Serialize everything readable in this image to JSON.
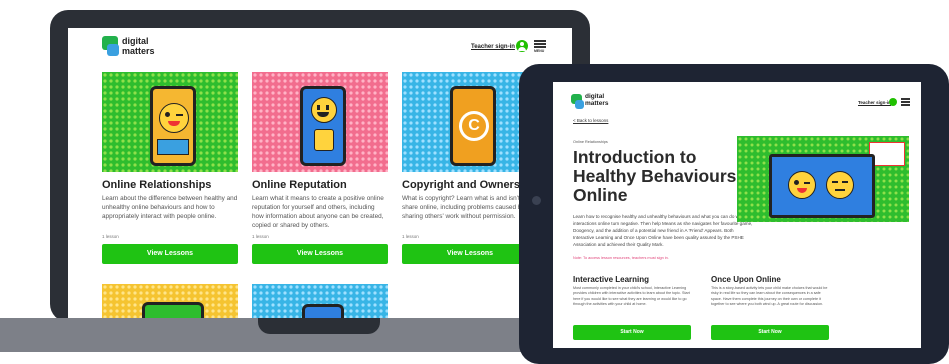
{
  "laptop": {
    "brand_line1": "digital",
    "brand_line2": "matters",
    "teacher_signin": "Teacher sign-in",
    "menu_label": "MENU",
    "cards": [
      {
        "title": "Online Relationships",
        "desc": "Learn about the difference between healthy and unhealthy online behaviours and how to appropriately interact with people online.",
        "lessons": "1 lesson",
        "button": "View Lessons",
        "bg": "#2ebd2e"
      },
      {
        "title": "Online Reputation",
        "desc": "Learn what it means to create a positive online reputation for yourself and others, including how information about anyone can be created, copied or shared by others.",
        "lessons": "1 lesson",
        "button": "View Lessons",
        "bg": "#f26d8e"
      },
      {
        "title": "Copyright and Ownership",
        "desc": "What is copyright? Learn what is and isn't ok to share online, including problems caused by sharing others' work without permission.",
        "lessons": "1 lesson",
        "button": "View Lessons",
        "bg": "#38b5e6"
      }
    ]
  },
  "tablet": {
    "brand_line1": "digital",
    "brand_line2": "matters",
    "teacher_signin": "Teacher sign-in",
    "back_link": "< Back to lessons",
    "category": "Online Relationships",
    "title": "Introduction to Healthy Behaviours Online",
    "intro": "Learn how to recognise healthy and unhealthy behaviours and what you can do when interactions online turn negative. Then help Means as she navigates her favourite game, Doogency, and the addition of a potential new friend in A 'Friend' Appears. Both Interactive Learning and Once Upon Online have been quality assured by the PSHE Association and achieved their Quality Mark.",
    "note": "Note: To access lesson resources, teachers must sign in.",
    "sections": [
      {
        "title": "Interactive Learning",
        "desc": "Most commonly completed in your child's school, Interactive Learning provides children with interactive activities to learn about the topic. Start here if you would like to see what they are learning or would like to go through the activities with your child at home.",
        "button": "Start Now"
      },
      {
        "title": "Once Upon Online",
        "desc": "This is a story-based activity lets your child make choices that would be risky in real life so they can learn about the consequences in a safe space. Have them complete this journey on their own or complete it together to see where you both wind up. A great route for discussion.",
        "button": "Start Now"
      }
    ]
  },
  "colors": {
    "accent_green": "#1fc313",
    "dark": "#222222",
    "frame": "#2b2f36"
  }
}
